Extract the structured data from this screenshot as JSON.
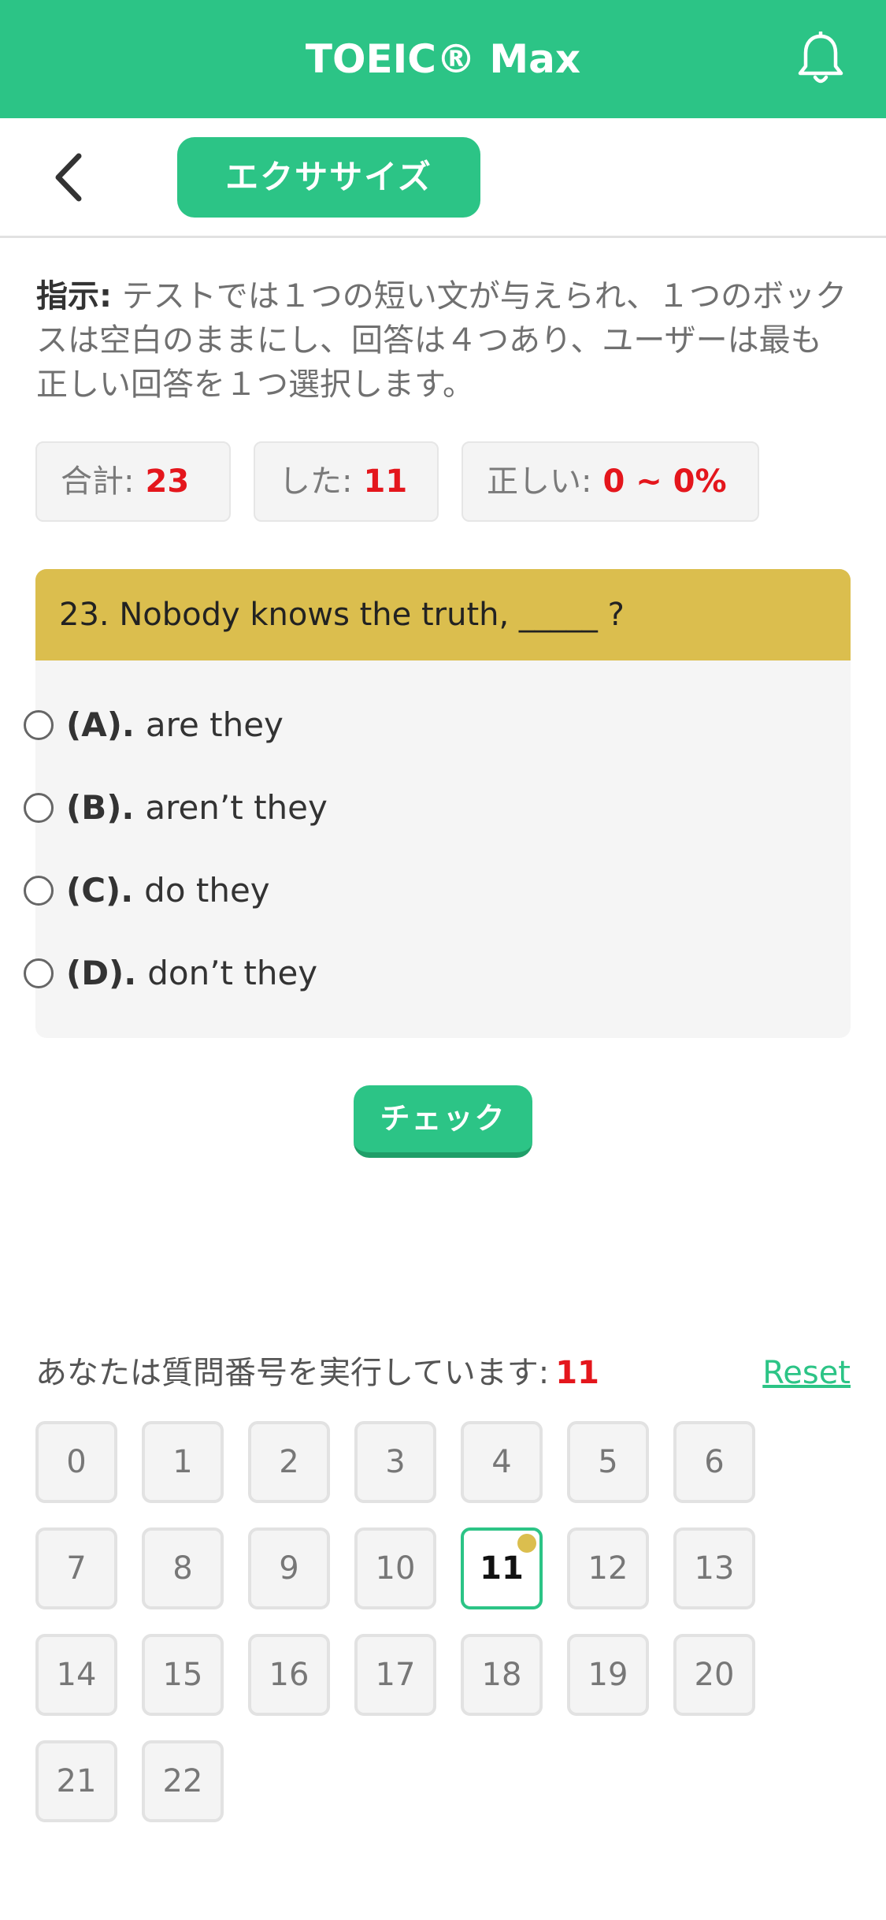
{
  "header": {
    "title": "TOEIC® Max",
    "bell_icon": "bell-icon",
    "background": "#2cc486"
  },
  "subbar": {
    "back_icon": "chevron-left-icon",
    "tab_label": "エクササイズ"
  },
  "instructions": {
    "label": "指示:",
    "text": " テストでは１つの短い文が与えられ、１つのボックスは空白のままにし、回答は４つあり、ユーザーは最も正しい回答を１つ選択します。"
  },
  "stats": {
    "total_label": "合計:",
    "total_value": "23",
    "done_label": "した:",
    "done_value": "11",
    "correct_label": "正しい:",
    "correct_value": "0 ~ 0%"
  },
  "question": {
    "text": "23. Nobody knows the truth, _____ ?",
    "options": [
      {
        "letter": "(A).",
        "text": "are they"
      },
      {
        "letter": "(B).",
        "text": "aren’t they"
      },
      {
        "letter": "(C).",
        "text": "do they"
      },
      {
        "letter": "(D).",
        "text": "don’t they"
      }
    ]
  },
  "check_button": {
    "label": "チェック"
  },
  "progress": {
    "label": "あなたは質問番号を実行しています:",
    "current": "11",
    "reset_label": "Reset"
  },
  "question_numbers": [
    "0",
    "1",
    "2",
    "3",
    "4",
    "5",
    "6",
    "7",
    "8",
    "9",
    "10",
    "11",
    "12",
    "13",
    "14",
    "15",
    "16",
    "17",
    "18",
    "19",
    "20",
    "21",
    "22"
  ],
  "colors": {
    "accent": "#2cc486",
    "question_header": "#dbbe4e",
    "highlight_red": "#e4161c"
  }
}
